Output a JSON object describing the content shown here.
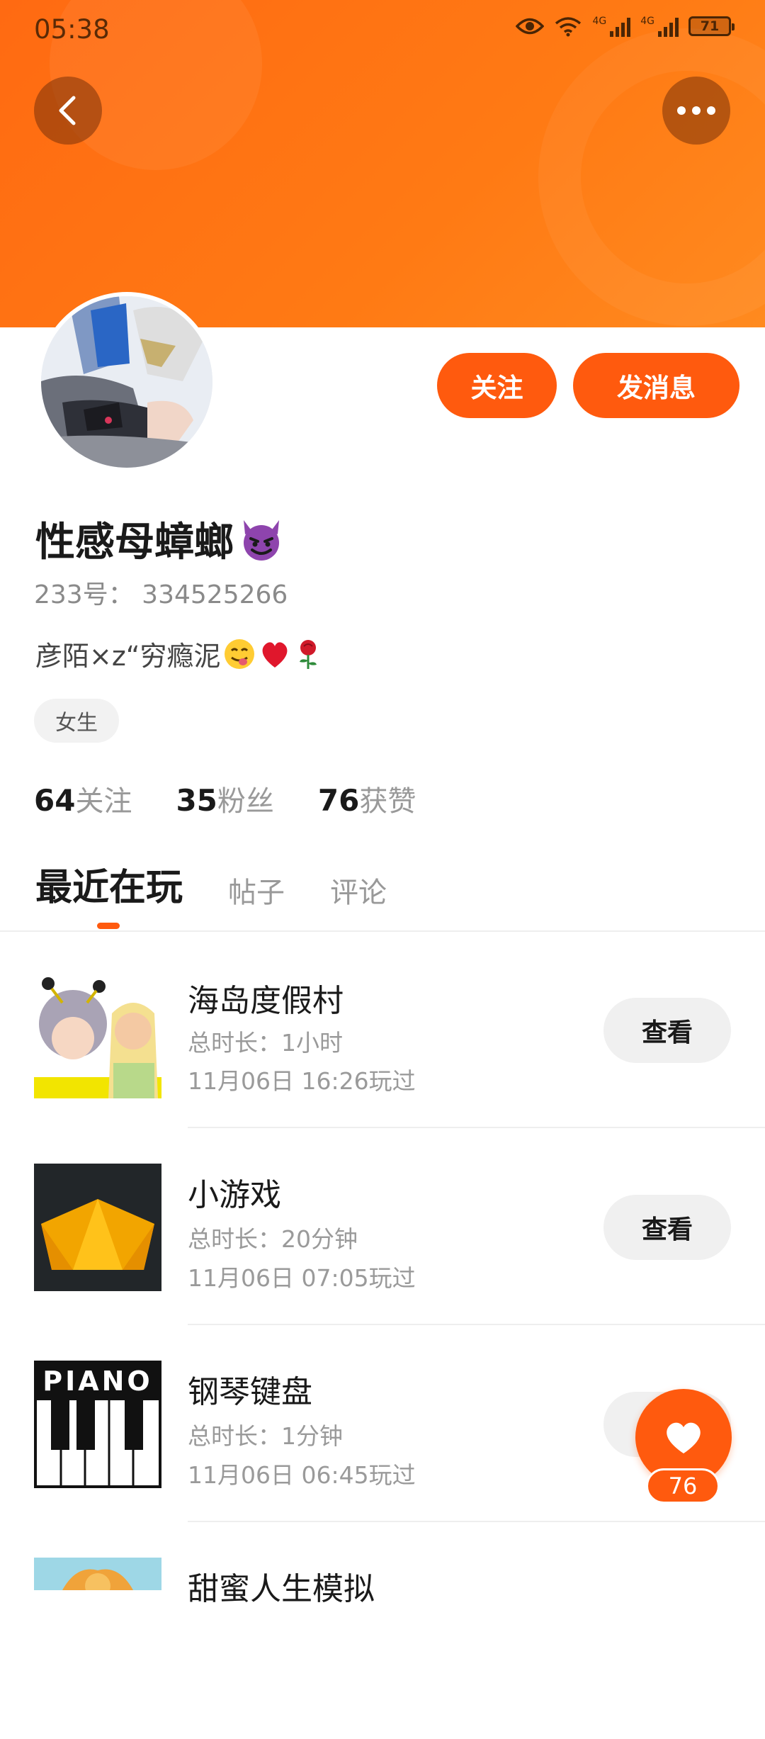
{
  "status_bar": {
    "time": "05:38",
    "network_1": "4G",
    "network_2": "4G",
    "battery": "71"
  },
  "header": {
    "back_label": "<",
    "more_label": "..."
  },
  "actions": {
    "follow_label": "关注",
    "message_label": "发消息"
  },
  "profile": {
    "nickname": "性感母蟑螂",
    "uid_label": "233号：",
    "uid": "334525266",
    "bio": "彦陌×z“穷瘾泥",
    "gender": "女生"
  },
  "stats": [
    {
      "num": "64",
      "label": "关注"
    },
    {
      "num": "35",
      "label": "粉丝"
    },
    {
      "num": "76",
      "label": "获赞"
    }
  ],
  "tabs": [
    {
      "label": "最近在玩",
      "active": true
    },
    {
      "label": "帖子",
      "active": false
    },
    {
      "label": "评论",
      "active": false
    }
  ],
  "games": [
    {
      "name": "海岛度假村",
      "duration": "总时长：1小时",
      "last_played": "11月06日 16:26玩过",
      "button": "查看"
    },
    {
      "name": "小游戏",
      "duration": "总时长：20分钟",
      "last_played": "11月06日 07:05玩过",
      "button": "查看"
    },
    {
      "name": "钢琴键盘",
      "duration": "总时长：1分钟",
      "last_played": "11月06日 06:45玩过",
      "button": "查看",
      "thumb_text": "PIANO"
    },
    {
      "name": "甜蜜人生模拟",
      "duration": "",
      "last_played": "",
      "button": ""
    }
  ],
  "like_fab": {
    "count": "76"
  },
  "colors": {
    "accent": "#ff5a0e",
    "hero_start": "#ff6a12",
    "hero_end": "#ff8a1f"
  }
}
